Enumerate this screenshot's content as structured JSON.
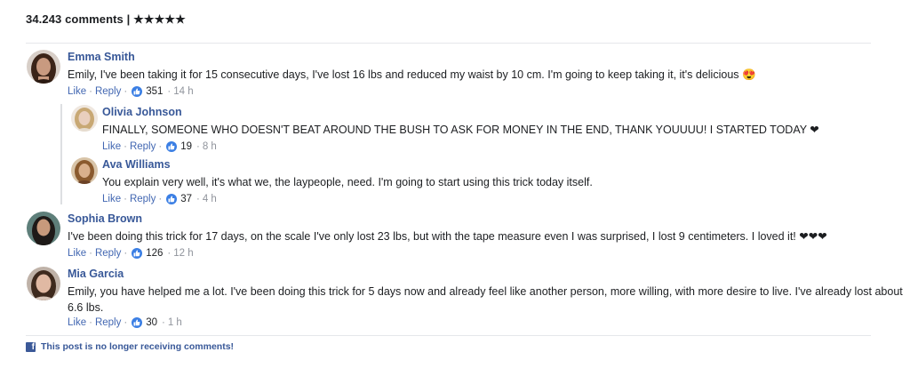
{
  "header": {
    "count_text": "34.243 comments",
    "separator": "|",
    "stars": "★★★★★"
  },
  "actions": {
    "like": "Like",
    "reply": "Reply",
    "dot": "·"
  },
  "comments": [
    {
      "name": "Emma Smith",
      "text": "Emily, I've been taking it for 15 consecutive days, I've lost 16 lbs and reduced my waist by 10 cm. I'm going to keep taking it, it's delicious 😍",
      "likes": "351",
      "time": "14 h",
      "avatar_colors": {
        "hair": "#3b2418",
        "skin": "#c89a80",
        "bg": "#d8cfc8"
      }
    },
    {
      "name": "Olivia Johnson",
      "text": "FINALLY, SOMEONE WHO DOESN'T BEAT AROUND THE BUSH TO ASK FOR MONEY IN THE END, THANK YOUUUU! I STARTED TODAY ❤",
      "likes": "19",
      "time": "8 h",
      "avatar_colors": {
        "hair": "#c8a874",
        "skin": "#e9cfbe",
        "bg": "#efe7df"
      }
    },
    {
      "name": "Ava Williams",
      "text": "You explain very well, it's what we, the laypeople, need. I'm going to start using this trick today itself.",
      "likes": "37",
      "time": "4 h",
      "avatar_colors": {
        "hair": "#8a5a2e",
        "skin": "#d9b08c",
        "bg": "#d8c4a8"
      }
    },
    {
      "name": "Sophia Brown",
      "text": "I've been doing this trick for 17 days, on the scale I've only lost 23 lbs, but with the tape measure even I was surprised, I lost 9 centimeters. I loved it! ❤❤❤",
      "likes": "126",
      "time": "12 h",
      "avatar_colors": {
        "hair": "#1e1a18",
        "skin": "#c79a7c",
        "bg": "#5e7f7a"
      }
    },
    {
      "name": "Mia Garcia",
      "text_line1": "Emily, you have helped me a lot. I've been doing this trick for 5 days now and already feel like another person, more willing, with more desire to live. I've already lost about",
      "text_line2": "6.6 lbs.",
      "likes": "30",
      "time": "1 h",
      "avatar_colors": {
        "hair": "#3e2a1e",
        "skin": "#e0b9a3",
        "bg": "#bfb2a8"
      }
    }
  ],
  "footer": {
    "text": "This post is no longer receiving comments!"
  },
  "colors": {
    "name": "#385898",
    "link": "#4267b2",
    "like_icon": "#3b7fe4",
    "facebook": "#3b5998"
  }
}
